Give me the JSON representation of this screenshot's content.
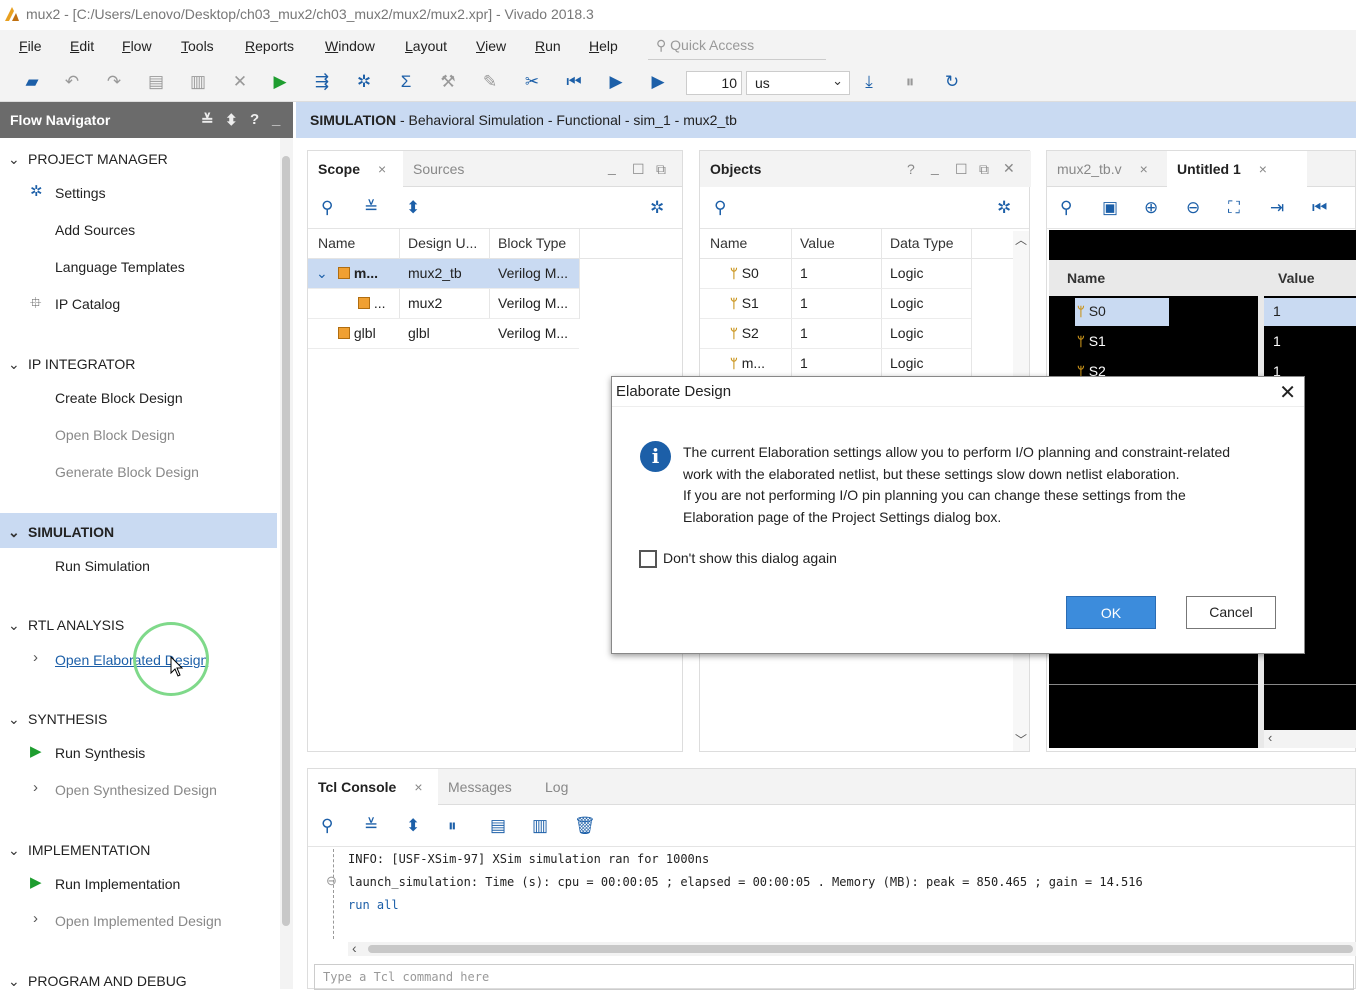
{
  "window": {
    "title": "mux2 - [C:/Users/Lenovo/Desktop/ch03_mux2/ch03_mux2/mux2/mux2.xpr] - Vivado 2018.3"
  },
  "menu": [
    "File",
    "Edit",
    "Flow",
    "Tools",
    "Reports",
    "Window",
    "Layout",
    "View",
    "Run",
    "Help"
  ],
  "quick_access": {
    "placeholder": "Quick Access"
  },
  "toolbar": {
    "time_value": "10",
    "time_unit": "us"
  },
  "flow_navigator": {
    "title": "Flow Navigator",
    "sections": [
      {
        "label": "PROJECT MANAGER",
        "items": [
          "Settings",
          "Add Sources",
          "Language Templates",
          "IP Catalog"
        ]
      },
      {
        "label": "IP INTEGRATOR",
        "items": [
          "Create Block Design",
          "Open Block Design",
          "Generate Block Design"
        ]
      },
      {
        "label": "SIMULATION",
        "items": [
          "Run Simulation"
        ]
      },
      {
        "label": "RTL ANALYSIS",
        "items": [
          "Open Elaborated Design"
        ]
      },
      {
        "label": "SYNTHESIS",
        "items": [
          "Run Synthesis",
          "Open Synthesized Design"
        ]
      },
      {
        "label": "IMPLEMENTATION",
        "items": [
          "Run Implementation",
          "Open Implemented Design"
        ]
      },
      {
        "label": "PROGRAM AND DEBUG",
        "items": []
      }
    ]
  },
  "sim_header": {
    "bold": "SIMULATION",
    "rest": " - Behavioral Simulation - Functional - sim_1 - mux2_tb"
  },
  "scope_panel": {
    "tabs": [
      "Scope",
      "Sources"
    ],
    "columns": [
      "Name",
      "Design U...",
      "Block Type"
    ],
    "rows": [
      {
        "name": "m...",
        "design_unit": "mux2_tb",
        "block_type": "Verilog M..."
      },
      {
        "name": "...",
        "design_unit": "mux2",
        "block_type": "Verilog M..."
      },
      {
        "name": "glbl",
        "design_unit": "glbl",
        "block_type": "Verilog M..."
      }
    ]
  },
  "objects_panel": {
    "title": "Objects",
    "help": "?",
    "columns": [
      "Name",
      "Value",
      "Data Type"
    ],
    "rows": [
      {
        "name": "S0",
        "value": "1",
        "type": "Logic"
      },
      {
        "name": "S1",
        "value": "1",
        "type": "Logic"
      },
      {
        "name": "S2",
        "value": "1",
        "type": "Logic"
      },
      {
        "name": "m...",
        "value": "1",
        "type": "Logic"
      }
    ]
  },
  "wave_panel": {
    "tabs": [
      "mux2_tb.v",
      "Untitled 1"
    ],
    "columns": [
      "Name",
      "Value"
    ],
    "rows": [
      {
        "name": "S0",
        "value": "1"
      },
      {
        "name": "S1",
        "value": "1"
      },
      {
        "name": "S2",
        "value": "1"
      }
    ]
  },
  "dialog": {
    "title": "Elaborate Design",
    "lines": [
      "The current Elaboration settings allow you to perform I/O planning and constraint-related",
      "work with the elaborated netlist, but these settings slow down netlist elaboration.",
      "If you are not performing I/O pin planning you can change these settings from the",
      "Elaboration page of the Project Settings dialog box."
    ],
    "checkbox_label": "Don't show this dialog again",
    "ok": "OK",
    "cancel": "Cancel"
  },
  "tcl_console": {
    "tabs": [
      "Tcl Console",
      "Messages",
      "Log"
    ],
    "lines": [
      "INFO: [USF-XSim-97] XSim simulation ran for 1000ns",
      "launch_simulation: Time (s): cpu = 00:00:05 ; elapsed = 00:00:05 . Memory (MB): peak = 850.465 ; gain = 14.516",
      "run all"
    ],
    "input_placeholder": "Type a Tcl command here"
  },
  "colors": {
    "accent": "#1c5fa8",
    "highlight": "#c9daf2",
    "ok_button": "#3c8cdc",
    "run_green": "#1e9d2f"
  }
}
